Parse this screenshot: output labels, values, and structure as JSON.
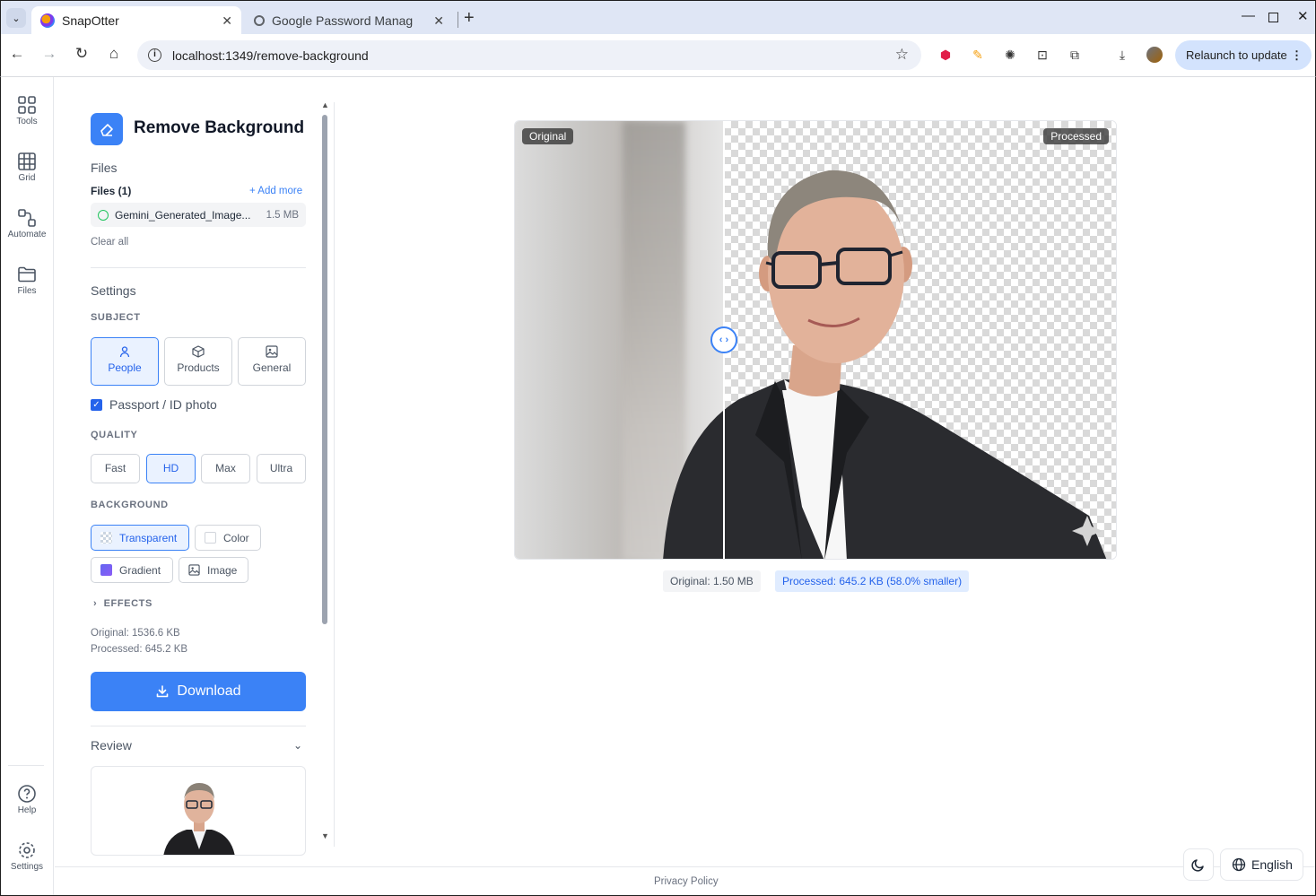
{
  "browser": {
    "tabs": [
      {
        "title": "SnapOtter",
        "active": true
      },
      {
        "title": "Google Password Manag",
        "active": false
      }
    ],
    "url": "localhost:1349/remove-background",
    "relaunch_label": "Relaunch to update"
  },
  "rail": {
    "items": [
      {
        "label": "Tools",
        "icon": "grid-icon"
      },
      {
        "label": "Grid",
        "icon": "table-icon"
      },
      {
        "label": "Automate",
        "icon": "workflow-icon"
      },
      {
        "label": "Files",
        "icon": "folder-icon"
      }
    ],
    "bottom": [
      {
        "label": "Help",
        "icon": "help-icon"
      },
      {
        "label": "Settings",
        "icon": "gear-icon"
      }
    ]
  },
  "panel": {
    "title": "Remove Background",
    "files_heading": "Files",
    "files_count": "Files (1)",
    "add_more": "+ Add more",
    "file": {
      "name": "Gemini_Generated_Image...",
      "size": "1.5 MB"
    },
    "clear_all": "Clear all",
    "settings_heading": "Settings",
    "subject_label": "SUBJECT",
    "subjects": [
      {
        "label": "People",
        "selected": true
      },
      {
        "label": "Products",
        "selected": false
      },
      {
        "label": "General",
        "selected": false
      }
    ],
    "passport_label": "Passport / ID photo",
    "passport_checked": true,
    "quality_label": "QUALITY",
    "quality": [
      {
        "label": "Fast",
        "selected": false
      },
      {
        "label": "HD",
        "selected": true
      },
      {
        "label": "Max",
        "selected": false
      },
      {
        "label": "Ultra",
        "selected": false
      }
    ],
    "background_label": "BACKGROUND",
    "backgrounds": [
      {
        "label": "Transparent",
        "selected": true
      },
      {
        "label": "Color",
        "selected": false
      },
      {
        "label": "Gradient",
        "selected": false
      },
      {
        "label": "Image",
        "selected": false
      }
    ],
    "effects_label": "EFFECTS",
    "original_stat": "Original: 1536.6 KB",
    "processed_stat": "Processed: 645.2 KB",
    "download_label": "Download",
    "review_label": "Review"
  },
  "preview": {
    "original_tag": "Original",
    "processed_tag": "Processed",
    "original_size": "Original: 1.50 MB",
    "processed_size": "Processed: 645.2 KB (58.0% smaller)"
  },
  "footer": {
    "privacy": "Privacy Policy",
    "language": "English"
  },
  "colors": {
    "accent": "#3b82f6",
    "selected_bg": "#eaf2ff"
  }
}
